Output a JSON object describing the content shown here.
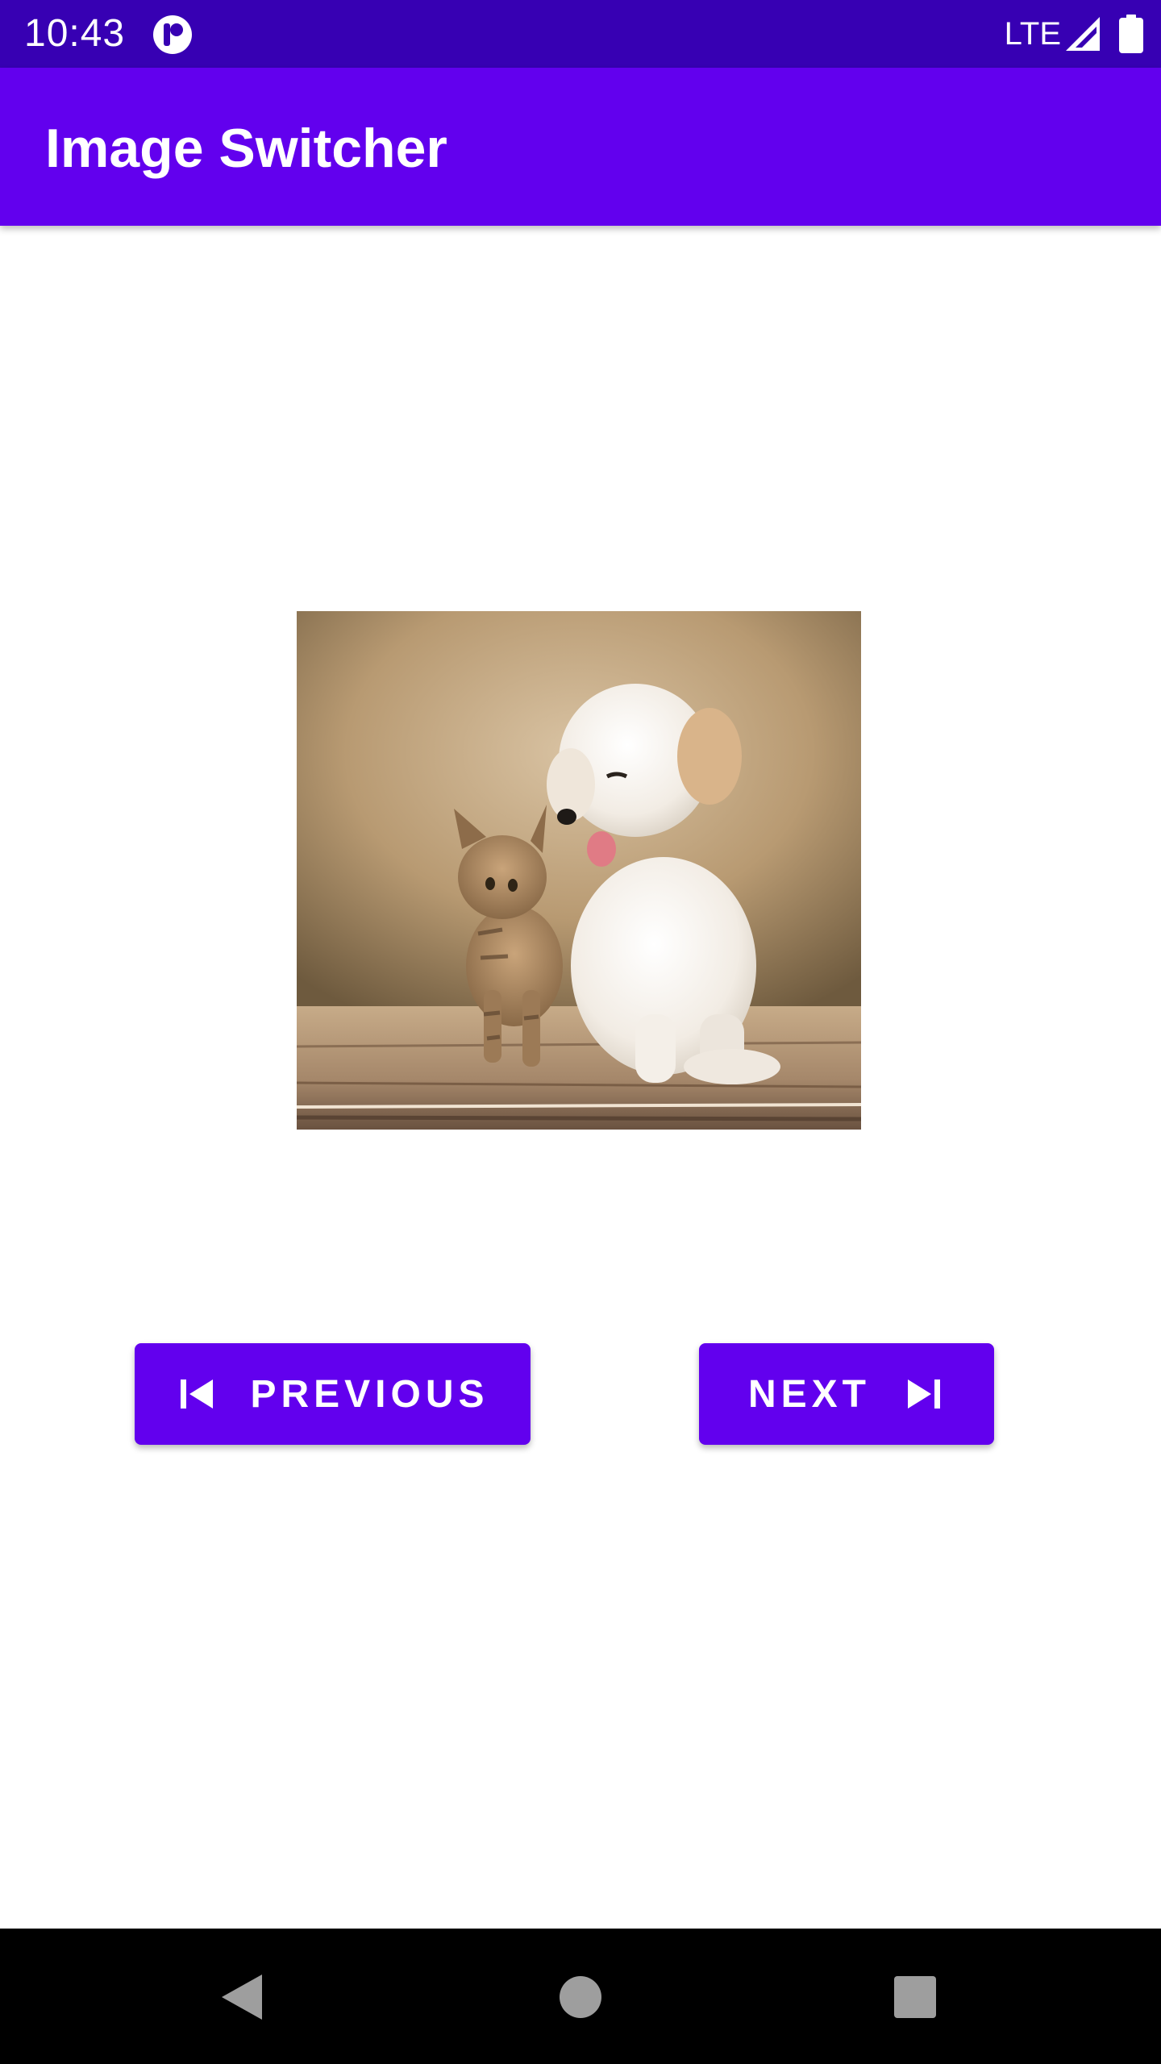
{
  "status_bar": {
    "time": "10:43",
    "network": "LTE",
    "icons": [
      "app-notification-icon",
      "signal-icon",
      "battery-icon"
    ]
  },
  "app_bar": {
    "title": "Image Switcher",
    "color": "#6200ee"
  },
  "image_switcher": {
    "image_description_icon": "photo"
  },
  "buttons": {
    "previous_label": "PREVIOUS",
    "previous_icon": "skip-previous-icon",
    "next_label": "NEXT",
    "next_icon": "skip-next-icon"
  },
  "nav_bar": {
    "icons": [
      "back-icon",
      "home-icon",
      "recents-icon"
    ]
  },
  "colors": {
    "status_bar": "#3700b3",
    "accent": "#6200ee",
    "nav_bar": "#000000"
  }
}
